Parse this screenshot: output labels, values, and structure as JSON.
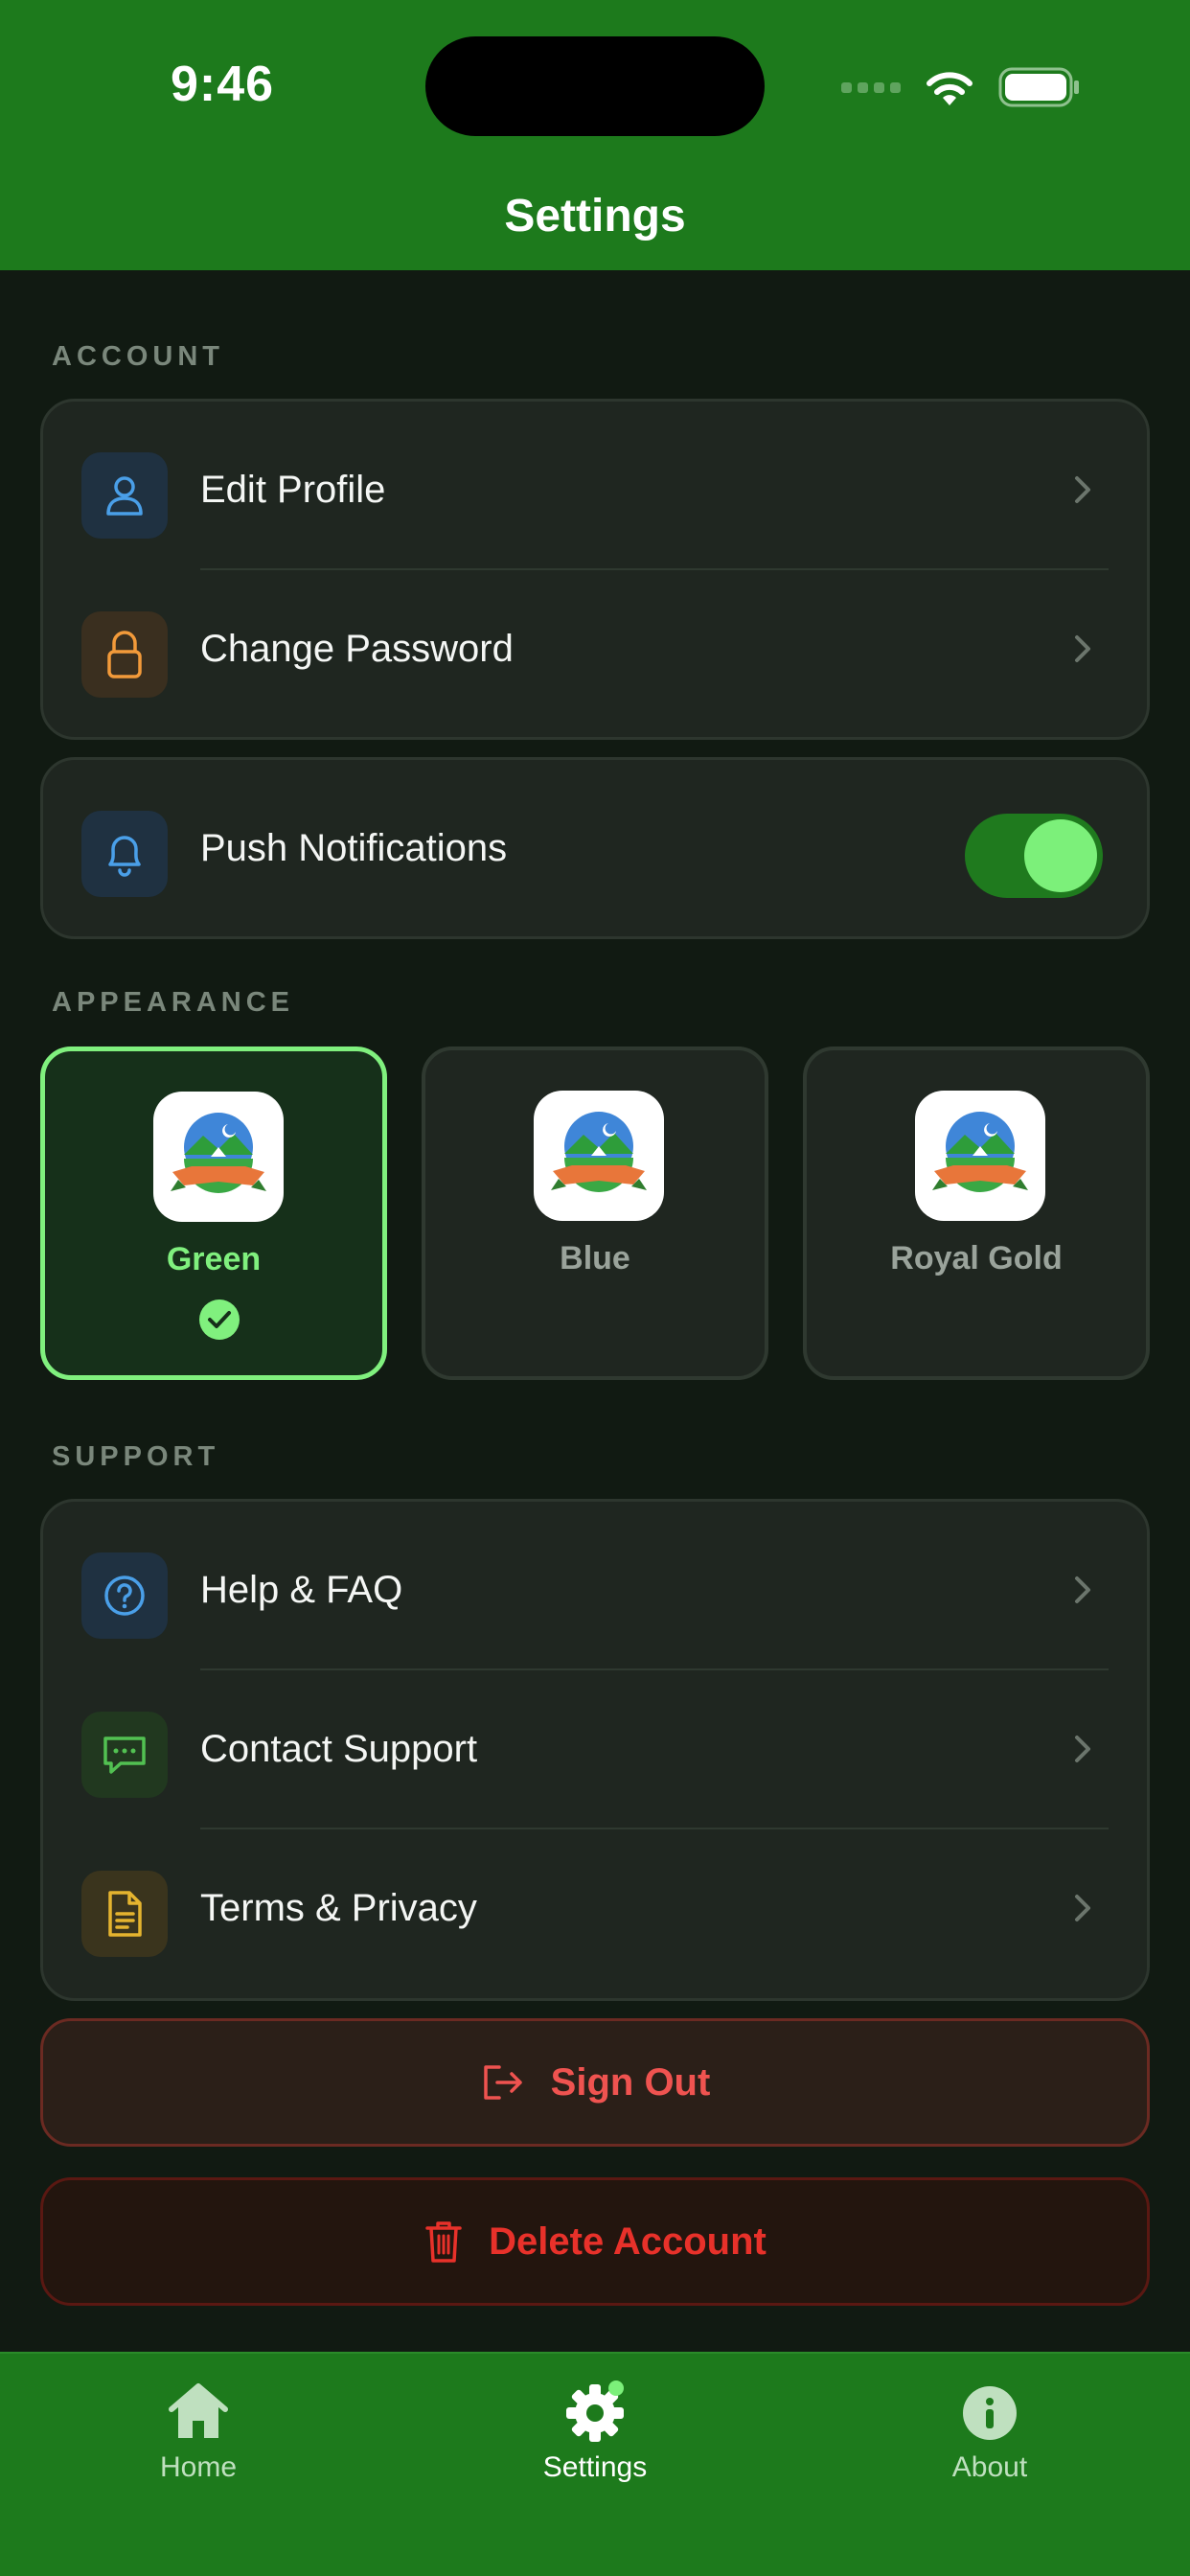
{
  "status_bar": {
    "time": "9:46"
  },
  "header": {
    "title": "Settings"
  },
  "sections": {
    "account": "ACCOUNT",
    "appearance": "APPEARANCE",
    "support": "SUPPORT"
  },
  "account_items": [
    {
      "label": "Edit Profile",
      "icon": "person-icon"
    },
    {
      "label": "Change Password",
      "icon": "lock-icon"
    }
  ],
  "notifications": {
    "label": "Push Notifications",
    "icon": "bell-icon",
    "enabled": true
  },
  "themes": [
    {
      "name": "Green",
      "selected": true
    },
    {
      "name": "Blue",
      "selected": false
    },
    {
      "name": "Royal Gold",
      "selected": false
    }
  ],
  "support_items": [
    {
      "label": "Help & FAQ",
      "icon": "question-circle-icon"
    },
    {
      "label": "Contact Support",
      "icon": "chat-bubble-icon"
    },
    {
      "label": "Terms & Privacy",
      "icon": "document-icon"
    }
  ],
  "actions": {
    "sign_out": "Sign Out",
    "delete_account": "Delete Account"
  },
  "tabs": [
    {
      "label": "Home",
      "icon": "home-icon",
      "active": false
    },
    {
      "label": "Settings",
      "icon": "gear-icon",
      "active": true
    },
    {
      "label": "About",
      "icon": "info-icon",
      "active": false
    }
  ],
  "colors": {
    "brand_green": "#1d7a1c",
    "accent_green": "#80f07e",
    "background": "#111a12",
    "card": "#1f2620",
    "danger": "#ef5350"
  }
}
